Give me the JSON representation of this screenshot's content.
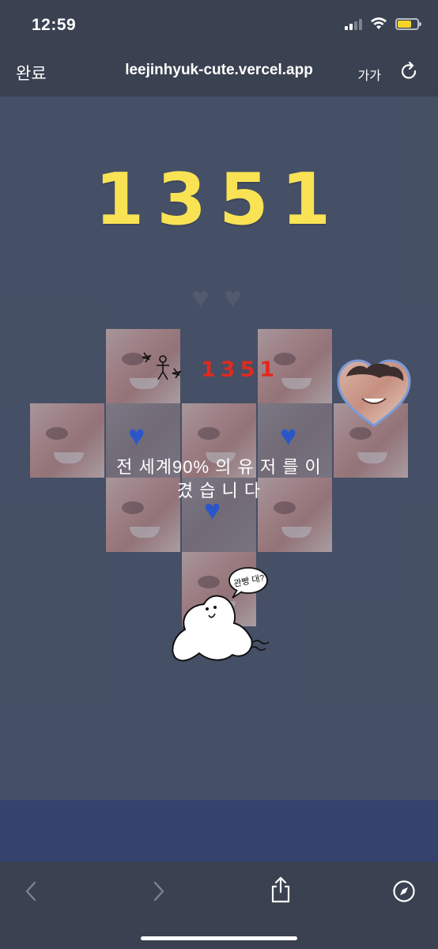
{
  "status_bar": {
    "time": "12:59"
  },
  "browser": {
    "done_label": "완료",
    "url": "leejinhyuk-cute.vercel.app",
    "text_size_label": "가가"
  },
  "game": {
    "score": "1351",
    "mini_score": "1351",
    "result_message_line1": "전 세계90% 의 유 저 를 이",
    "result_message_line2": "겼 습 니 다",
    "ghost_bubble_text": "관빵 대?"
  },
  "colors": {
    "score_yellow": "#f9e354",
    "mini_score_red": "#e02a1e",
    "heart_blue": "#2a56c9",
    "background": "#4a5368"
  },
  "toolbar": {
    "icons": [
      "back-icon",
      "forward-icon",
      "share-icon",
      "compass-icon"
    ]
  }
}
